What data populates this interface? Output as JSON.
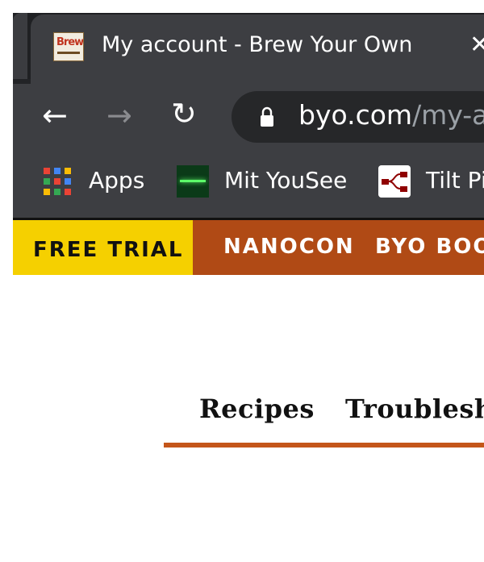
{
  "browser": {
    "tab": {
      "title": "My account - Brew Your Own",
      "close_glyph": "✕",
      "favicon_text": "Brew"
    },
    "toolbar": {
      "back_glyph": "←",
      "forward_glyph": "→",
      "reload_glyph": "↻",
      "url_host": "byo.com",
      "url_path": "/my-ac"
    },
    "bookmarks": [
      {
        "label": "Apps",
        "icon": "apps-grid-icon"
      },
      {
        "label": "Mit YouSee",
        "icon": "yousee-icon"
      },
      {
        "label": "Tilt Pi",
        "icon": "node-flow-icon"
      }
    ],
    "colors": {
      "chrome_dark": "#1f2023",
      "chrome_mid": "#3d3e42",
      "omnibox": "#262729"
    }
  },
  "site": {
    "top_nav": {
      "free_trial": "FREE TRIAL",
      "links": [
        "NANOCON",
        "BYO BOOKS"
      ]
    },
    "sub_nav": {
      "links": [
        "Recipes",
        "Troubleshooting"
      ]
    },
    "colors": {
      "free_trial_bg": "#f5d000",
      "nav_bg": "#b04a15",
      "underline": "#c4561a"
    }
  }
}
